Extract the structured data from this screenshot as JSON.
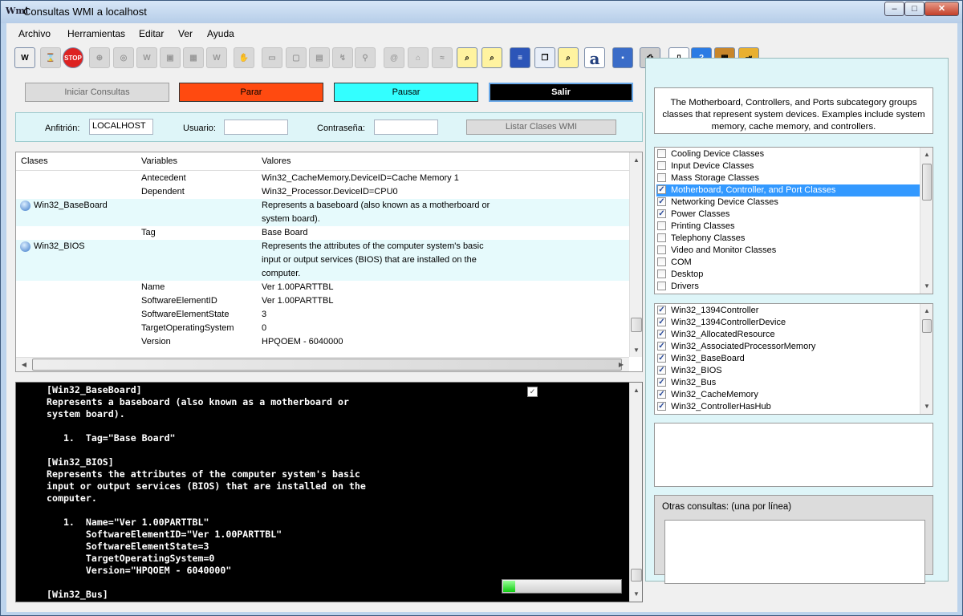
{
  "window": {
    "title": "Consultas WMI a localhost",
    "min": "‒",
    "max": "□",
    "close": "✕",
    "icon_text": "Wmi"
  },
  "menu": [
    "Archivo",
    "Herramientas",
    "Editar",
    "Ver",
    "Ayuda"
  ],
  "toolbar_icons": [
    "wmi-icon",
    "hourglass-icon",
    "stop-icon",
    "target-icon",
    "search-globe-icon",
    "wmi-1963-icon",
    "image-icon",
    "grid-icon",
    "wmi-alt-icon",
    "hands-icon",
    "computer-icon",
    "monitor-icon",
    "screen-icon",
    "network-icon",
    "plug-icon",
    "at-icon",
    "bank-icon",
    "cable-icon",
    "search-icon",
    "search-key-icon",
    "list-icon",
    "copy-icon",
    "find-icon",
    "font-icon",
    "save-icon",
    "print-icon",
    "document-icon",
    "help-icon",
    "grid-tool-icon",
    "exit-icon"
  ],
  "buttons": {
    "start": "Iniciar Consultas",
    "stop": "Parar",
    "pause": "Pausar",
    "exit": "Salir",
    "list_classes": "Listar Clases WMI"
  },
  "connection": {
    "host_label": "Anfitrión:",
    "host_value": "LOCALHOST",
    "user_label": "Usuario:",
    "user_value": "",
    "password_label": "Contraseña:",
    "password_value": ""
  },
  "grid": {
    "headers": [
      "Clases",
      "Variables",
      "Valores"
    ],
    "rows": [
      {
        "cls": "",
        "var": "Antecedent",
        "val": [
          "Win32_CacheMemory.DeviceID=Cache Memory 1"
        ]
      },
      {
        "cls": "",
        "var": "Dependent",
        "val": [
          "Win32_Processor.DeviceID=CPU0"
        ]
      },
      {
        "cls": "Win32_BaseBoard",
        "var": "",
        "val": [
          "Represents a baseboard (also known as a motherboard or",
          "system board)."
        ]
      },
      {
        "cls": "",
        "var": "Tag",
        "val": [
          "Base Board"
        ]
      },
      {
        "cls": "Win32_BIOS",
        "var": "",
        "val": [
          "Represents the attributes of the computer system's basic",
          "input or output services (BIOS) that are installed on the",
          "computer."
        ]
      },
      {
        "cls": "",
        "var": "Name",
        "val": [
          "Ver 1.00PARTTBL"
        ]
      },
      {
        "cls": "",
        "var": "SoftwareElementID",
        "val": [
          "Ver 1.00PARTTBL"
        ]
      },
      {
        "cls": "",
        "var": "SoftwareElementState",
        "val": [
          "3"
        ]
      },
      {
        "cls": "",
        "var": "TargetOperatingSystem",
        "val": [
          "0"
        ]
      },
      {
        "cls": "",
        "var": "Version",
        "val": [
          "HPQOEM - 6040000"
        ]
      }
    ]
  },
  "console": {
    "lines": [
      "[Win32_BaseBoard]",
      "Represents a baseboard (also known as a motherboard or",
      "system board).",
      "",
      "   1.  Tag=\"Base Board\"",
      "",
      "[Win32_BIOS]",
      "Represents the attributes of the computer system's basic",
      "input or output services (BIOS) that are installed on the",
      "computer.",
      "",
      "   1.  Name=\"Ver 1.00PARTTBL\"",
      "       SoftwareElementID=\"Ver 1.00PARTTBL\"",
      "       SoftwareElementState=3",
      "       TargetOperatingSystem=0",
      "       Version=\"HPQOEM - 6040000\"",
      "",
      "[Win32_Bus]"
    ],
    "progress": 0.1
  },
  "description": "The Motherboard, Controllers, and Ports subcategory groups classes that represent system devices. Examples include system memory, cache memory, and controllers.",
  "categories": [
    {
      "label": "Cooling Device Classes",
      "checked": false,
      "selected": false
    },
    {
      "label": "Input Device Classes",
      "checked": false,
      "selected": false
    },
    {
      "label": "Mass Storage Classes",
      "checked": false,
      "selected": false
    },
    {
      "label": "Motherboard, Controller, and Port Classes",
      "checked": true,
      "selected": true
    },
    {
      "label": "Networking Device Classes",
      "checked": true,
      "selected": false
    },
    {
      "label": "Power Classes",
      "checked": true,
      "selected": false
    },
    {
      "label": "Printing Classes",
      "checked": false,
      "selected": false
    },
    {
      "label": "Telephony Classes",
      "checked": false,
      "selected": false
    },
    {
      "label": "Video and Monitor Classes",
      "checked": false,
      "selected": false
    },
    {
      "label": "COM",
      "checked": false,
      "selected": false
    },
    {
      "label": "Desktop",
      "checked": false,
      "selected": false
    },
    {
      "label": "Drivers",
      "checked": false,
      "selected": false
    }
  ],
  "classes": [
    {
      "label": "Win32_1394Controller",
      "checked": true
    },
    {
      "label": "Win32_1394ControllerDevice",
      "checked": true
    },
    {
      "label": "Win32_AllocatedResource",
      "checked": true
    },
    {
      "label": "Win32_AssociatedProcessorMemory",
      "checked": true
    },
    {
      "label": "Win32_BaseBoard",
      "checked": true
    },
    {
      "label": "Win32_BIOS",
      "checked": true
    },
    {
      "label": "Win32_Bus",
      "checked": true
    },
    {
      "label": "Win32_CacheMemory",
      "checked": true
    },
    {
      "label": "Win32_ControllerHasHub",
      "checked": true
    }
  ],
  "other_queries": {
    "label": "Otras consultas: (una por línea)",
    "value": ""
  },
  "colors": {
    "stop": "#ff4a10",
    "pause": "#33ffff",
    "exit": "#000000",
    "panel": "#def5f8",
    "highlight": "#e6fafc",
    "progress": "#22cc22"
  }
}
